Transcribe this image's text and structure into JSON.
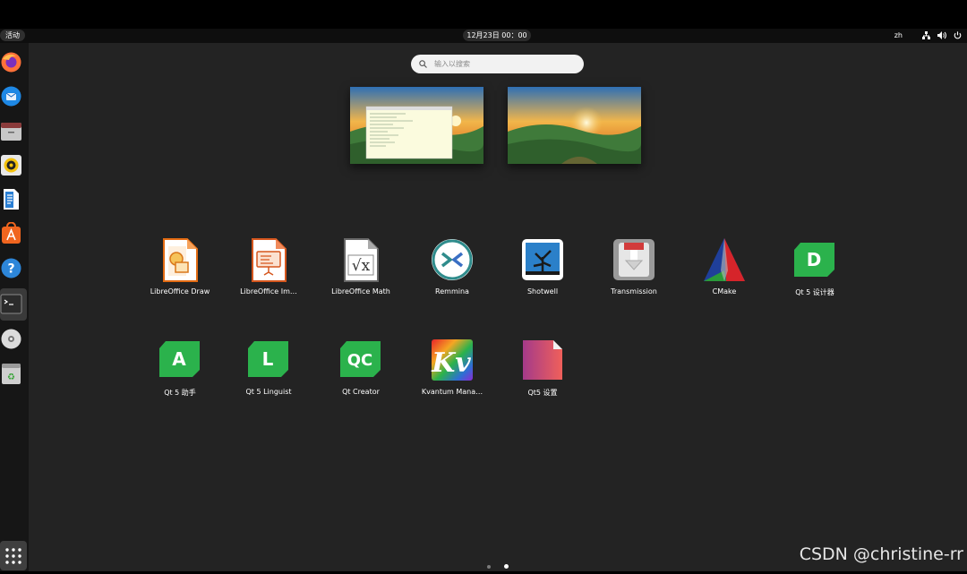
{
  "panel": {
    "activities": "活动",
    "clock": "12月23日 00：00",
    "lang": "zh",
    "tray_icons": [
      "network-icon",
      "volume-icon",
      "power-icon"
    ]
  },
  "dock": {
    "items": [
      "firefox-icon",
      "thunderbird-icon",
      "files-icon",
      "rhythmbox-icon",
      "writer-icon",
      "software-icon",
      "help-icon",
      "terminal-icon",
      "disc-icon",
      "trash-icon"
    ],
    "show_apps_icon": "show-apps-icon"
  },
  "search": {
    "placeholder": "输入以搜索"
  },
  "workspaces": [
    "workspace-1",
    "workspace-2"
  ],
  "apps": [
    {
      "name": "LibreOffice Draw"
    },
    {
      "name": "LibreOffice Im…"
    },
    {
      "name": "LibreOffice Math"
    },
    {
      "name": "Remmina"
    },
    {
      "name": "Shotwell"
    },
    {
      "name": "Transmission"
    },
    {
      "name": "CMake"
    },
    {
      "name": "Qt 5 设计器"
    },
    {
      "name": "Qt 5 助手"
    },
    {
      "name": "Qt 5 Linguist"
    },
    {
      "name": "Qt Creator"
    },
    {
      "name": "Kvantum Mana…"
    },
    {
      "name": "Qt5 设置"
    }
  ],
  "pager": {
    "pages": 2,
    "current": 2
  },
  "watermark": "CSDN @christine-rr",
  "colors": {
    "desktop": "#232323",
    "dock": "#161616",
    "qt_green": "#2bb24c"
  }
}
